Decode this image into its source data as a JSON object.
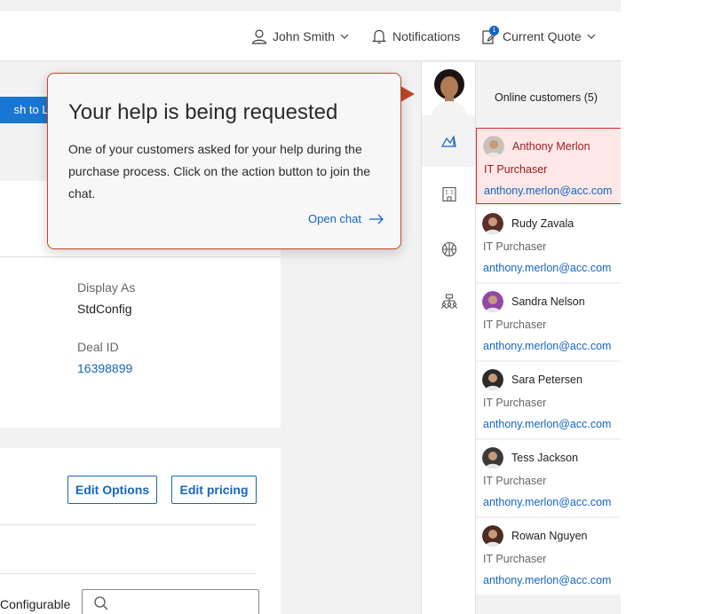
{
  "header": {
    "user_name": "John Smith",
    "notifications_label": "Notifications",
    "quote_label": "Current Quote",
    "quote_badge": "1"
  },
  "quote": {
    "publish_button": "sh to Liv",
    "display_as_label": "Display As",
    "display_as_value": "StdConfig",
    "deal_id_label": "Deal ID",
    "deal_id_value": "16398899",
    "edit_options_button": "Edit Options",
    "edit_pricing_button": "Edit pricing",
    "configurable_label": "Configurable",
    "search_value": ""
  },
  "help_popover": {
    "title": "Your help is being requested",
    "body": "One of your customers asked for your help during the purchase process. Click on the action button to join the chat.",
    "action": "Open chat"
  },
  "rail": {
    "icons": [
      "analytics-icon",
      "building-icon",
      "basketball-icon",
      "org-chart-icon"
    ],
    "active_index": 0
  },
  "customers": {
    "title": "Online customers (5)",
    "selected_index": 0,
    "list": [
      {
        "name": "Anthony Merlon",
        "role": "IT Purchaser",
        "email": "anthony.merlon@acc.com",
        "avatar_color": "#c9c2bb"
      },
      {
        "name": "Rudy Zavala",
        "role": "IT Purchaser",
        "email": "anthony.merlon@acc.com",
        "avatar_color": "#5a2f2a"
      },
      {
        "name": "Sandra Nelson",
        "role": "IT Purchaser",
        "email": "anthony.merlon@acc.com",
        "avatar_color": "#8e4aa8"
      },
      {
        "name": "Sara Petersen",
        "role": "IT Purchaser",
        "email": "anthony.merlon@acc.com",
        "avatar_color": "#2b2b2b"
      },
      {
        "name": "Tess Jackson",
        "role": "IT Purchaser",
        "email": "anthony.merlon@acc.com",
        "avatar_color": "#3a3a3a"
      },
      {
        "name": "Rowan Nguyen",
        "role": "IT Purchaser",
        "email": "anthony.merlon@acc.com",
        "avatar_color": "#4a2c22"
      }
    ]
  },
  "colors": {
    "accent": "#1565c0",
    "alert": "#c0472a",
    "selected_bg": "#fde7e7"
  }
}
